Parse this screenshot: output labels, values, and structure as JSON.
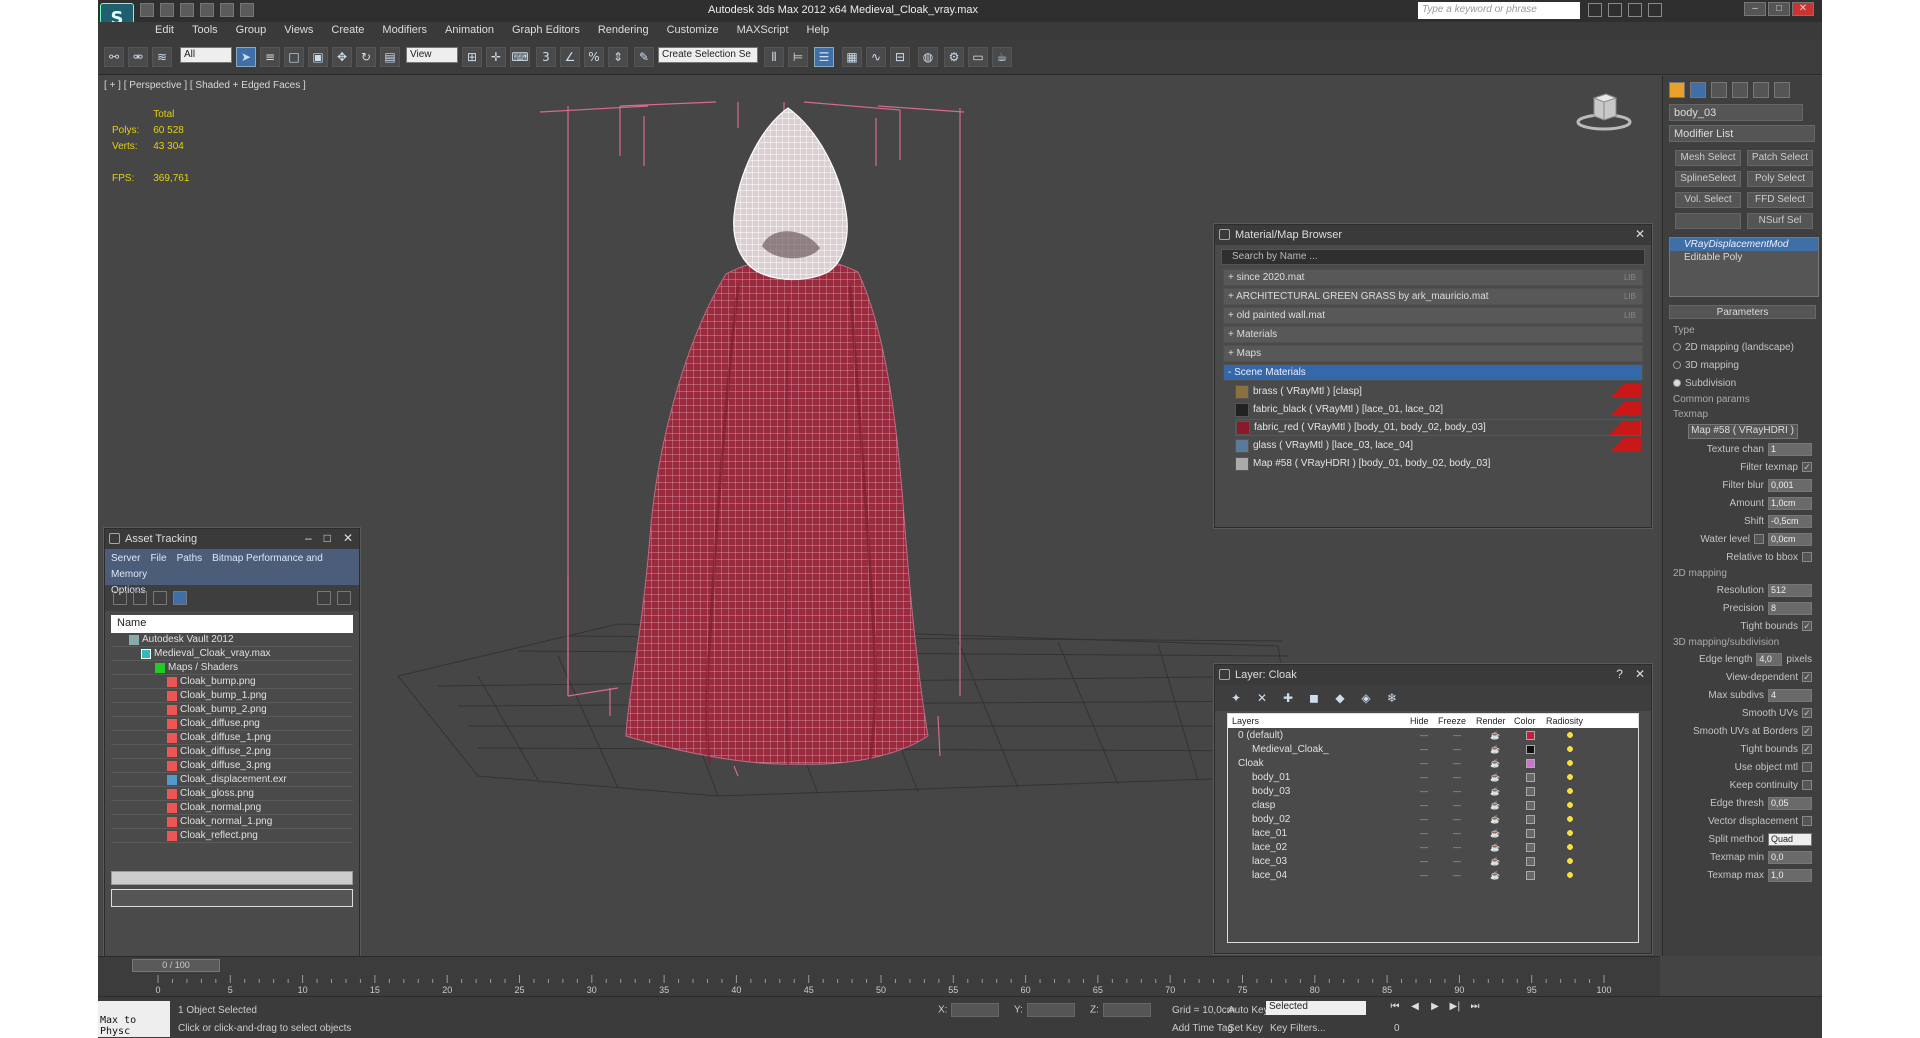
{
  "app": {
    "title": "Autodesk 3ds Max  2012 x64     Medieval_Cloak_vray.max",
    "search_placeholder": "Type a keyword or phrase"
  },
  "menu": [
    "Edit",
    "Tools",
    "Group",
    "Views",
    "Create",
    "Modifiers",
    "Animation",
    "Graph Editors",
    "Rendering",
    "Customize",
    "MAXScript",
    "Help"
  ],
  "toolbar": {
    "filter": "All",
    "ref_coord": "View",
    "named_sel": "Create Selection Se"
  },
  "viewport": {
    "label": "[ + ] [ Perspective ] [ Shaded + Edged Faces ]",
    "total": "Total",
    "polys_label": "Polys:",
    "polys": "60 528",
    "verts_label": "Verts:",
    "verts": "43 304",
    "fps_label": "FPS:",
    "fps": "369,761"
  },
  "cmd": {
    "object_name": "body_03",
    "modifier_list": "Modifier List",
    "mod_buttons": [
      "Mesh Select",
      "Patch Select",
      "SplineSelect",
      "Poly Select",
      "Vol. Select",
      "FFD Select",
      "",
      "NSurf Sel"
    ],
    "stack": [
      "VRayDisplacementMod",
      "Editable Poly"
    ],
    "rollout": "Parameters",
    "type_label": "Type",
    "types": [
      "2D mapping (landscape)",
      "3D mapping",
      "Subdivision"
    ],
    "common": "Common params",
    "texmap_label": "Texmap",
    "texmap": "Map #58  ( VRayHDRI )",
    "texture_chan": "Texture chan",
    "texture_chan_v": "1",
    "filter_texmap": "Filter texmap",
    "filter_blur": "Filter blur",
    "filter_blur_v": "0,001",
    "amount": "Amount",
    "amount_v": "1,0cm",
    "shift": "Shift",
    "shift_v": "-0,5cm",
    "water": "Water level",
    "water_v": "0,0cm",
    "relative": "Relative to bbox",
    "sec_2d": "2D mapping",
    "resolution": "Resolution",
    "resolution_v": "512",
    "precision": "Precision",
    "precision_v": "8",
    "tight": "Tight bounds",
    "sec_3d": "3D mapping/subdivision",
    "edge_len": "Edge length",
    "edge_len_v": "4,0",
    "pixels": "pixels",
    "view_dep": "View-dependent",
    "max_subdivs": "Max subdivs",
    "max_subdivs_v": "4",
    "smooth_uvs": "Smooth UVs",
    "smooth_borders": "Smooth UVs at Borders",
    "tight2": "Tight bounds",
    "use_obj_mtl": "Use object mtl",
    "keep_cont": "Keep continuity",
    "edge_thresh": "Edge thresh",
    "edge_thresh_v": "0,05",
    "vector_disp": "Vector displacement",
    "split": "Split method",
    "split_v": "Quad",
    "texmap_min": "Texmap min",
    "texmap_min_v": "0,0",
    "texmap_max": "Texmap max",
    "texmap_max_v": "1,0"
  },
  "asset": {
    "title": "Asset Tracking",
    "menu": [
      "Server",
      "File",
      "Paths",
      "Bitmap Performance and Memory"
    ],
    "menu2": "Options",
    "col": "Name",
    "items": [
      "Autodesk Vault 2012",
      "Medieval_Cloak_vray.max",
      "Maps / Shaders",
      "Cloak_bump.png",
      "Cloak_bump_1.png",
      "Cloak_bump_2.png",
      "Cloak_diffuse.png",
      "Cloak_diffuse_1.png",
      "Cloak_diffuse_2.png",
      "Cloak_diffuse_3.png",
      "Cloak_displacement.exr",
      "Cloak_gloss.png",
      "Cloak_normal.png",
      "Cloak_normal_1.png",
      "Cloak_reflect.png"
    ]
  },
  "browser": {
    "title": "Material/Map Browser",
    "search": "Search by Name ...",
    "groups": [
      "+ since 2020.mat",
      "+ ARCHITECTURAL GREEN GRASS by ark_mauricio.mat",
      "+ old painted wall.mat",
      "+ Materials",
      "+ Maps",
      "- Scene Materials"
    ],
    "lib": "LIB",
    "mats": [
      "brass  ( VRayMtl )  [clasp]",
      "fabric_black  ( VRayMtl )  [lace_01, lace_02]",
      "fabric_red  ( VRayMtl )  [body_01, body_02, body_03]",
      "glass  ( VRayMtl )  [lace_03, lace_04]",
      "Map #58  ( VRayHDRI )  [body_01, body_02, body_03]"
    ]
  },
  "layers": {
    "title": "Layer: Cloak",
    "cols": [
      "Layers",
      "Hide",
      "Freeze",
      "Render",
      "Color",
      "Radiosity"
    ],
    "rows": [
      "0 (default)",
      "Medieval_Cloak_",
      "Cloak",
      "body_01",
      "body_03",
      "clasp",
      "body_02",
      "lace_01",
      "lace_02",
      "lace_03",
      "lace_04"
    ],
    "row_colors": [
      "#c0203a",
      "#111111",
      "#d070d0",
      "#666",
      "#666",
      "#666",
      "#666",
      "#666",
      "#666",
      "#666",
      "#666"
    ]
  },
  "timeline": {
    "pos": "0 / 100",
    "ticks": [
      "0",
      "5",
      "10",
      "15",
      "20",
      "25",
      "30",
      "35",
      "40",
      "45",
      "50",
      "55",
      "60",
      "65",
      "70",
      "75",
      "80",
      "85",
      "90",
      "95",
      "100"
    ]
  },
  "status": {
    "maxscript": "Max to Physc",
    "selected": "1 Object Selected",
    "hint": "Click or click-and-drag to select objects",
    "grid": "Grid = 10,0cm",
    "addtime": "Add Time Tag",
    "autokey": "Auto Key",
    "setkey": "Set Key",
    "selbox": "Selected",
    "keyfilters": "Key Filters...",
    "x": "X:",
    "y": "Y:",
    "z": "Z:",
    "frame": "0"
  }
}
